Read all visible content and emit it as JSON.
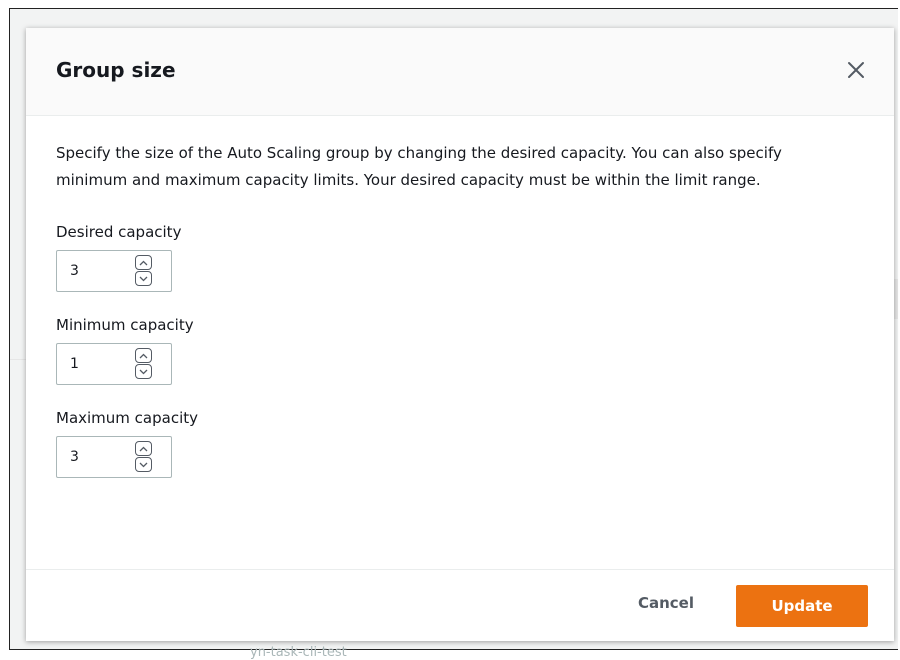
{
  "background": {
    "partial_text": "yn-task-cli-test"
  },
  "modal": {
    "title": "Group size",
    "close_icon": "close-icon",
    "description": "Specify the size of the Auto Scaling group by changing the desired capacity. You can also specify minimum and maximum capacity limits. Your desired capacity must be within the limit range.",
    "fields": [
      {
        "label": "Desired capacity",
        "value": "3"
      },
      {
        "label": "Minimum capacity",
        "value": "1"
      },
      {
        "label": "Maximum capacity",
        "value": "3"
      }
    ],
    "footer": {
      "cancel_label": "Cancel",
      "update_label": "Update"
    }
  },
  "colors": {
    "primary_button": "#ec7211",
    "text": "#16191f",
    "secondary_text": "#545b64"
  }
}
